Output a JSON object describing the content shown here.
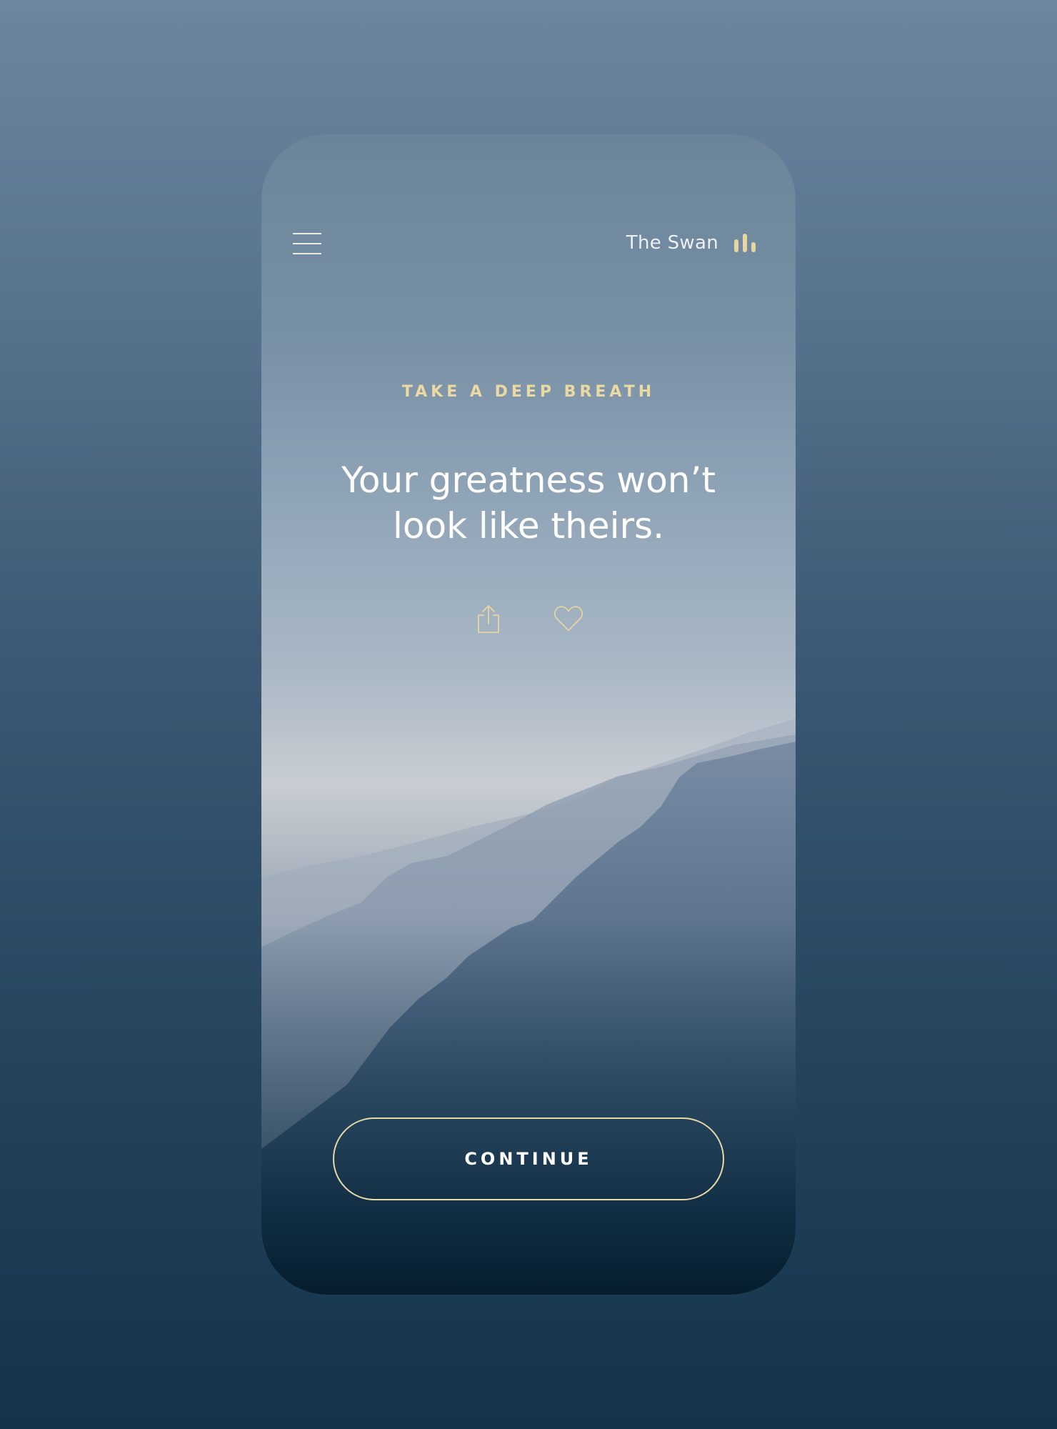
{
  "header": {
    "sound_label": "The Swan",
    "menu_icon": "hamburger-menu-icon",
    "sound_icon": "audio-bars-icon"
  },
  "content": {
    "kicker": "TAKE A DEEP BREATH",
    "quote": "Your greatness won’t look like theirs."
  },
  "actions": {
    "share_icon": "share-icon",
    "favorite_icon": "heart-icon"
  },
  "footer": {
    "continue_label": "CONTINUE"
  },
  "colors": {
    "accent": "#e6d7a0",
    "text": "#ffffff"
  }
}
